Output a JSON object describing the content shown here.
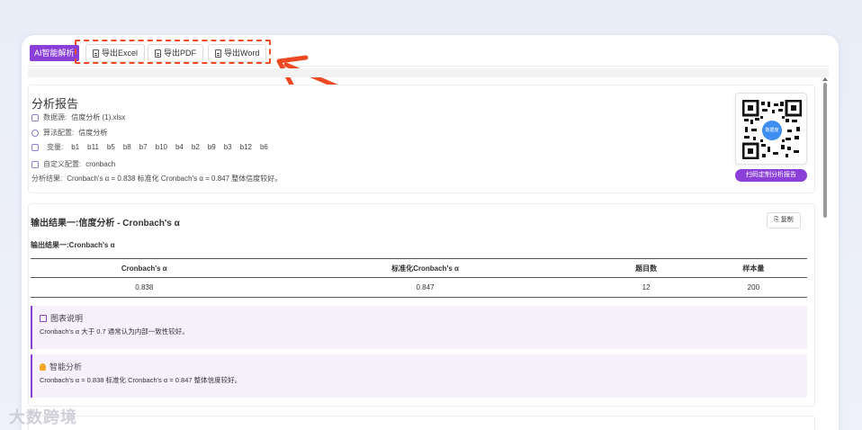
{
  "toolbar": {
    "ai_label": "AI智能解析",
    "exports": [
      "导出Excel",
      "导出PDF",
      "导出Word"
    ]
  },
  "report": {
    "title": "分析报告",
    "source_label": "数据源:",
    "source_value": "信度分析 (1).xlsx",
    "algo_label": "算法配置:",
    "algo_value": "信度分析",
    "vars_label": "变量:",
    "vars": [
      "b1",
      "b11",
      "b5",
      "b8",
      "b7",
      "b10",
      "b4",
      "b2",
      "b9",
      "b3",
      "b12",
      "b6"
    ],
    "custom_label": "自定义配置:",
    "custom_value": "cronbach",
    "result_label": "分析结果:",
    "result_value": "Cronbach's α = 0.838 标准化 Cronbach's α = 0.847 整体信度较好。",
    "qr_badge": "数据度",
    "scan_label": "扫码定制分析报告"
  },
  "result1": {
    "title": "输出结果一:信度分析 - Cronbach's α",
    "copy_label": "复制",
    "subtitle": "输出结果一:Cronbach's α",
    "headers": [
      "Cronbach's α",
      "标准化Cronbach's α",
      "题目数",
      "样本量"
    ],
    "row": [
      "0.838",
      "0.847",
      "12",
      "200"
    ],
    "note1_title": "图表说明",
    "note1_body": "Cronbach's α 大于 0.7 通常认为内部一致性较好。",
    "note2_title": "智能分析",
    "note2_body": "Cronbach's α = 0.838 标准化 Cronbach's α = 0.847 整体信度较好。"
  },
  "watermark": "大数跨境",
  "colors": {
    "accent": "#8b3fd9",
    "highlight": "#f04a24",
    "qr_center": "#3d8ef0"
  }
}
